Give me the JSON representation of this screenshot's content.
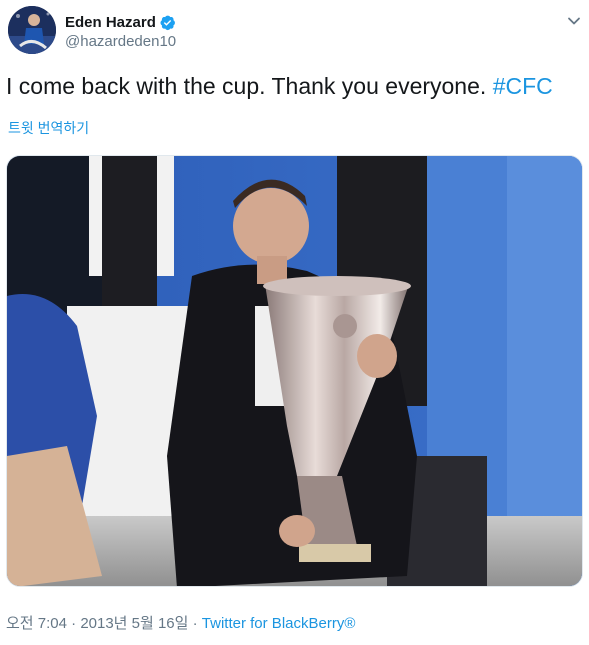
{
  "author": {
    "display_name": "Eden Hazard",
    "handle": "@hazardeden10",
    "verified_icon": "verified-badge-icon",
    "verified_color": "#1da1f2"
  },
  "tweet": {
    "text": "I come back with the cup. Thank you everyone. ",
    "hashtag": "#CFC",
    "translate_label": "트윗 번역하기"
  },
  "meta": {
    "time": "오전 7:04",
    "separator": "·",
    "date": "2013년 5월 16일",
    "source": "Twitter for BlackBerry®"
  },
  "colors": {
    "link": "#1b95e0",
    "muted": "#657786",
    "text": "#14171a"
  }
}
